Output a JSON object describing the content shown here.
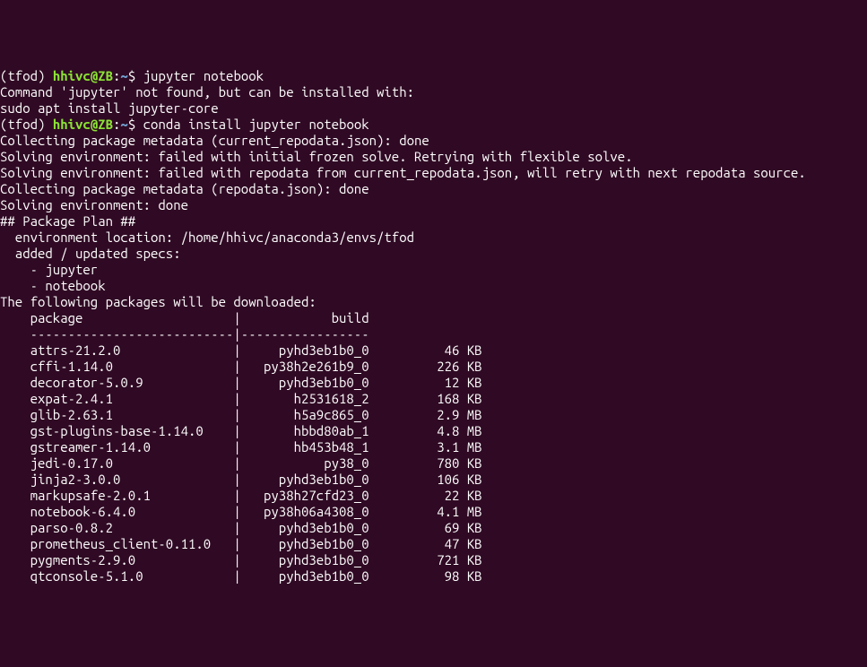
{
  "prompt1": {
    "env": "(tfod) ",
    "userhost": "hhivc@ZB",
    "colon": ":",
    "path": "~",
    "dollar": "$ ",
    "command": "jupyter notebook"
  },
  "blank1": "",
  "notfound": "Command 'jupyter' not found, but can be installed with:",
  "blank2": "",
  "sudo": "sudo apt install jupyter-core",
  "blank3": "",
  "prompt2": {
    "env": "(tfod) ",
    "userhost": "hhivc@ZB",
    "colon": ":",
    "path": "~",
    "dollar": "$ ",
    "command": "conda install jupyter notebook"
  },
  "meta1": "Collecting package metadata (current_repodata.json): done",
  "solve1": "Solving environment: failed with initial frozen solve. Retrying with flexible solve.",
  "solve2": "Solving environment: failed with repodata from current_repodata.json, will retry with next repodata source.",
  "meta2": "Collecting package metadata (repodata.json): done",
  "solve3": "Solving environment: done",
  "blank4": "",
  "planheader": "## Package Plan ##",
  "blank5": "",
  "envloc": "  environment location: /home/hhivc/anaconda3/envs/tfod",
  "blank6": "",
  "added": "  added / updated specs:",
  "spec1": "    - jupyter",
  "spec2": "    - notebook",
  "blank7": "",
  "blank8": "",
  "downloadheader": "The following packages will be downloaded:",
  "blank9": "",
  "tableheader": "    package                    |            build",
  "tablesep": "    ---------------------------|-----------------",
  "packages": [
    {
      "name": "attrs-21.2.0",
      "build": "pyhd3eb1b0_0",
      "size": "46 KB"
    },
    {
      "name": "cffi-1.14.0",
      "build": "py38h2e261b9_0",
      "size": "226 KB"
    },
    {
      "name": "decorator-5.0.9",
      "build": "pyhd3eb1b0_0",
      "size": "12 KB"
    },
    {
      "name": "expat-2.4.1",
      "build": "h2531618_2",
      "size": "168 KB"
    },
    {
      "name": "glib-2.63.1",
      "build": "h5a9c865_0",
      "size": "2.9 MB"
    },
    {
      "name": "gst-plugins-base-1.14.0",
      "build": "hbbd80ab_1",
      "size": "4.8 MB"
    },
    {
      "name": "gstreamer-1.14.0",
      "build": "hb453b48_1",
      "size": "3.1 MB"
    },
    {
      "name": "jedi-0.17.0",
      "build": "py38_0",
      "size": "780 KB"
    },
    {
      "name": "jinja2-3.0.0",
      "build": "pyhd3eb1b0_0",
      "size": "106 KB"
    },
    {
      "name": "markupsafe-2.0.1",
      "build": "py38h27cfd23_0",
      "size": "22 KB"
    },
    {
      "name": "notebook-6.4.0",
      "build": "py38h06a4308_0",
      "size": "4.1 MB"
    },
    {
      "name": "parso-0.8.2",
      "build": "pyhd3eb1b0_0",
      "size": "69 KB"
    },
    {
      "name": "prometheus_client-0.11.0",
      "build": "pyhd3eb1b0_0",
      "size": "47 KB"
    },
    {
      "name": "pygments-2.9.0",
      "build": "pyhd3eb1b0_0",
      "size": "721 KB"
    },
    {
      "name": "qtconsole-5.1.0",
      "build": "pyhd3eb1b0_0",
      "size": "98 KB"
    }
  ]
}
